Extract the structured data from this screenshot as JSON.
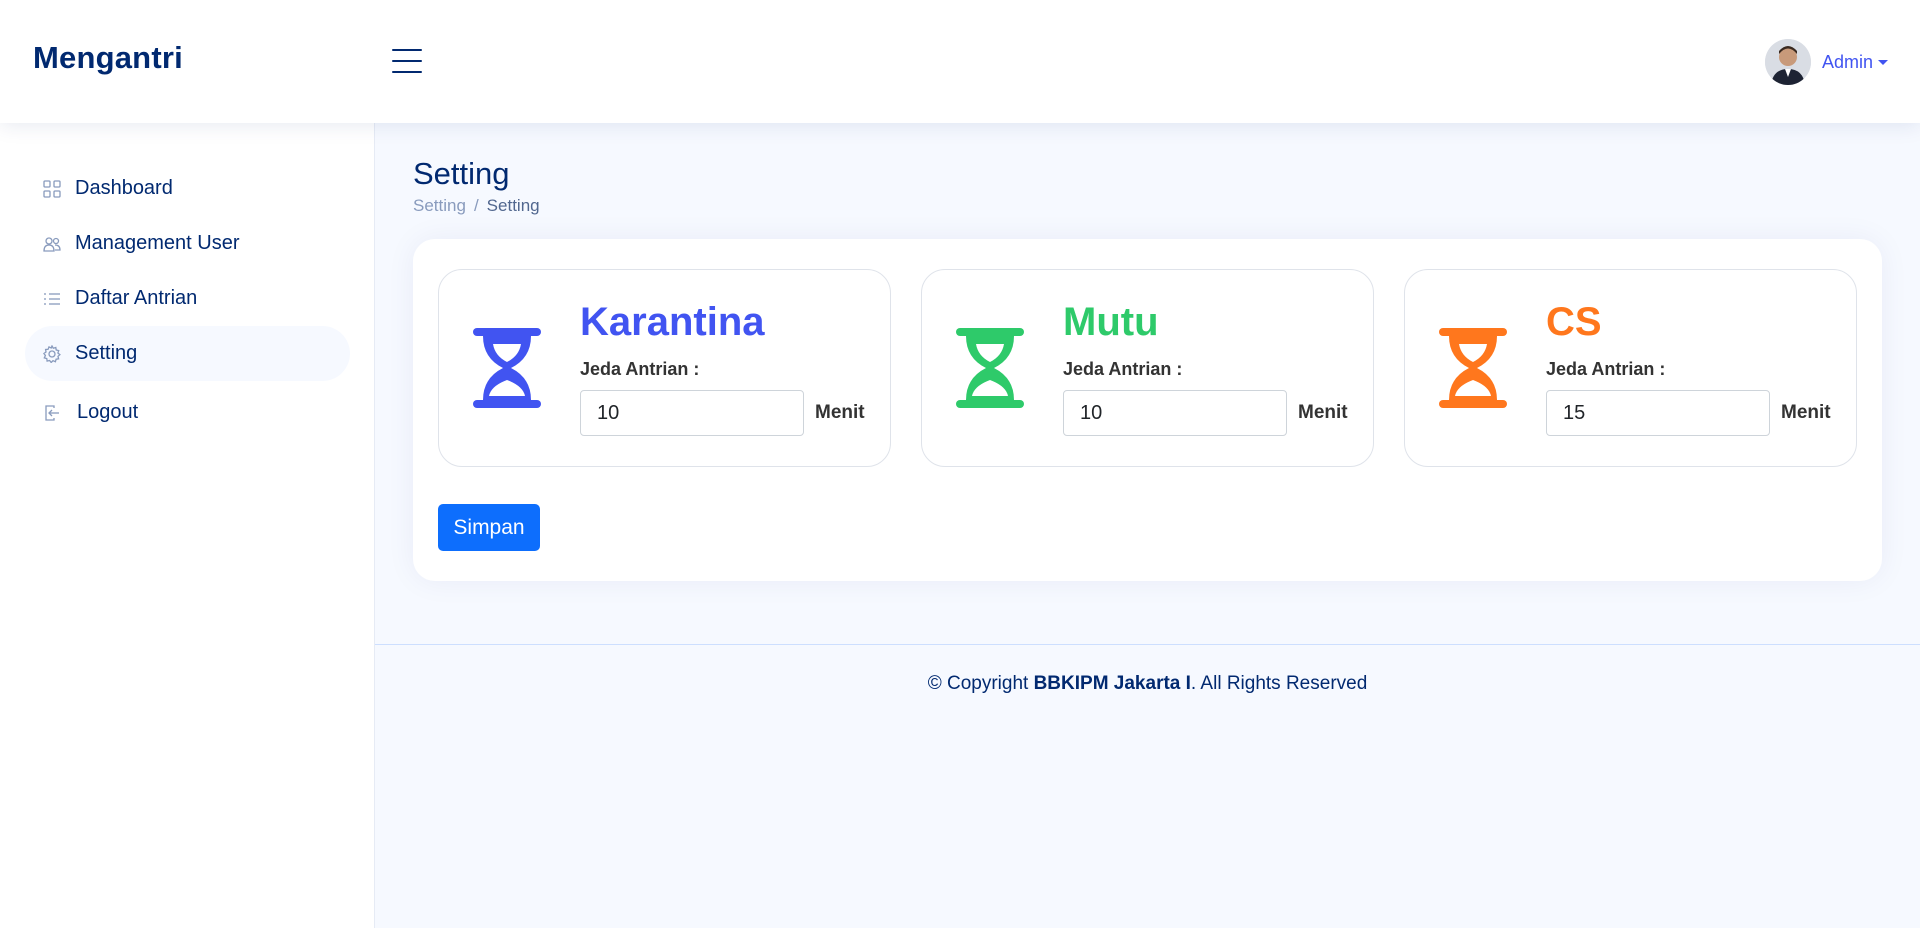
{
  "header": {
    "app_title": "Mengantri",
    "user_name": "Admin"
  },
  "sidebar": {
    "items": [
      {
        "label": "Dashboard",
        "icon": "grid-icon"
      },
      {
        "label": "Management User",
        "icon": "people-icon"
      },
      {
        "label": "Daftar Antrian",
        "icon": "list-icon"
      },
      {
        "label": "Setting",
        "icon": "gear-icon",
        "active": true
      },
      {
        "label": "Logout",
        "icon": "logout-icon"
      }
    ]
  },
  "page": {
    "title": "Setting",
    "breadcrumb": [
      "Setting",
      "Setting"
    ]
  },
  "queues": [
    {
      "name": "Karantina",
      "label": "Jeda Antrian :",
      "value": "10",
      "unit": "Menit",
      "color": "#4154f1",
      "icon": "hourglass-icon"
    },
    {
      "name": "Mutu",
      "label": "Jeda Antrian :",
      "value": "10",
      "unit": "Menit",
      "color": "#2eca6a",
      "icon": "hourglass-icon"
    },
    {
      "name": "CS",
      "label": "Jeda Antrian :",
      "value": "15",
      "unit": "Menit",
      "color": "#ff771d",
      "icon": "hourglass-icon"
    }
  ],
  "actions": {
    "save_label": "Simpan"
  },
  "footer": {
    "prefix": "© Copyright ",
    "org": "BBKIPM Jakarta I",
    "suffix": ". All Rights Reserved"
  }
}
